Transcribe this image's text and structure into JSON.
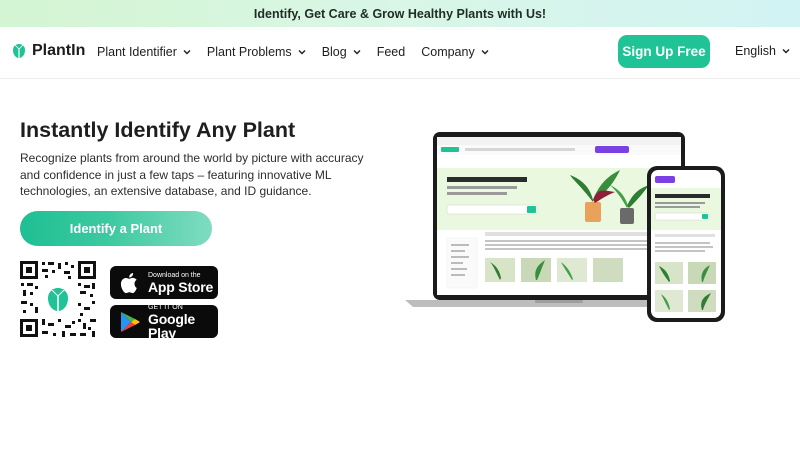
{
  "banner": {
    "text": "Identify, Get Care & Grow Healthy Plants with Us!"
  },
  "nav": {
    "logo_text": "PlantIn",
    "items": [
      {
        "label": "Plant Identifier",
        "has_dropdown": true
      },
      {
        "label": "Plant Problems",
        "has_dropdown": true
      },
      {
        "label": "Blog",
        "has_dropdown": true
      },
      {
        "label": "Feed",
        "has_dropdown": false
      },
      {
        "label": "Company",
        "has_dropdown": true
      }
    ],
    "signup_label": "Sign Up Free",
    "language": "English"
  },
  "hero": {
    "title": "Instantly Identify Any Plant",
    "description": "Recognize plants from around the world by picture with accuracy and confidence in just a few taps – featuring innovative ML technologies, an extensive database, and ID guidance.",
    "cta_label": "Identify a Plant"
  },
  "stores": {
    "apple_small": "Download on the",
    "apple_big": "App Store",
    "google_small": "GET IT ON",
    "google_big": "Google Play"
  },
  "colors": {
    "accent": "#1fc396",
    "purple": "#7b3fe4"
  }
}
